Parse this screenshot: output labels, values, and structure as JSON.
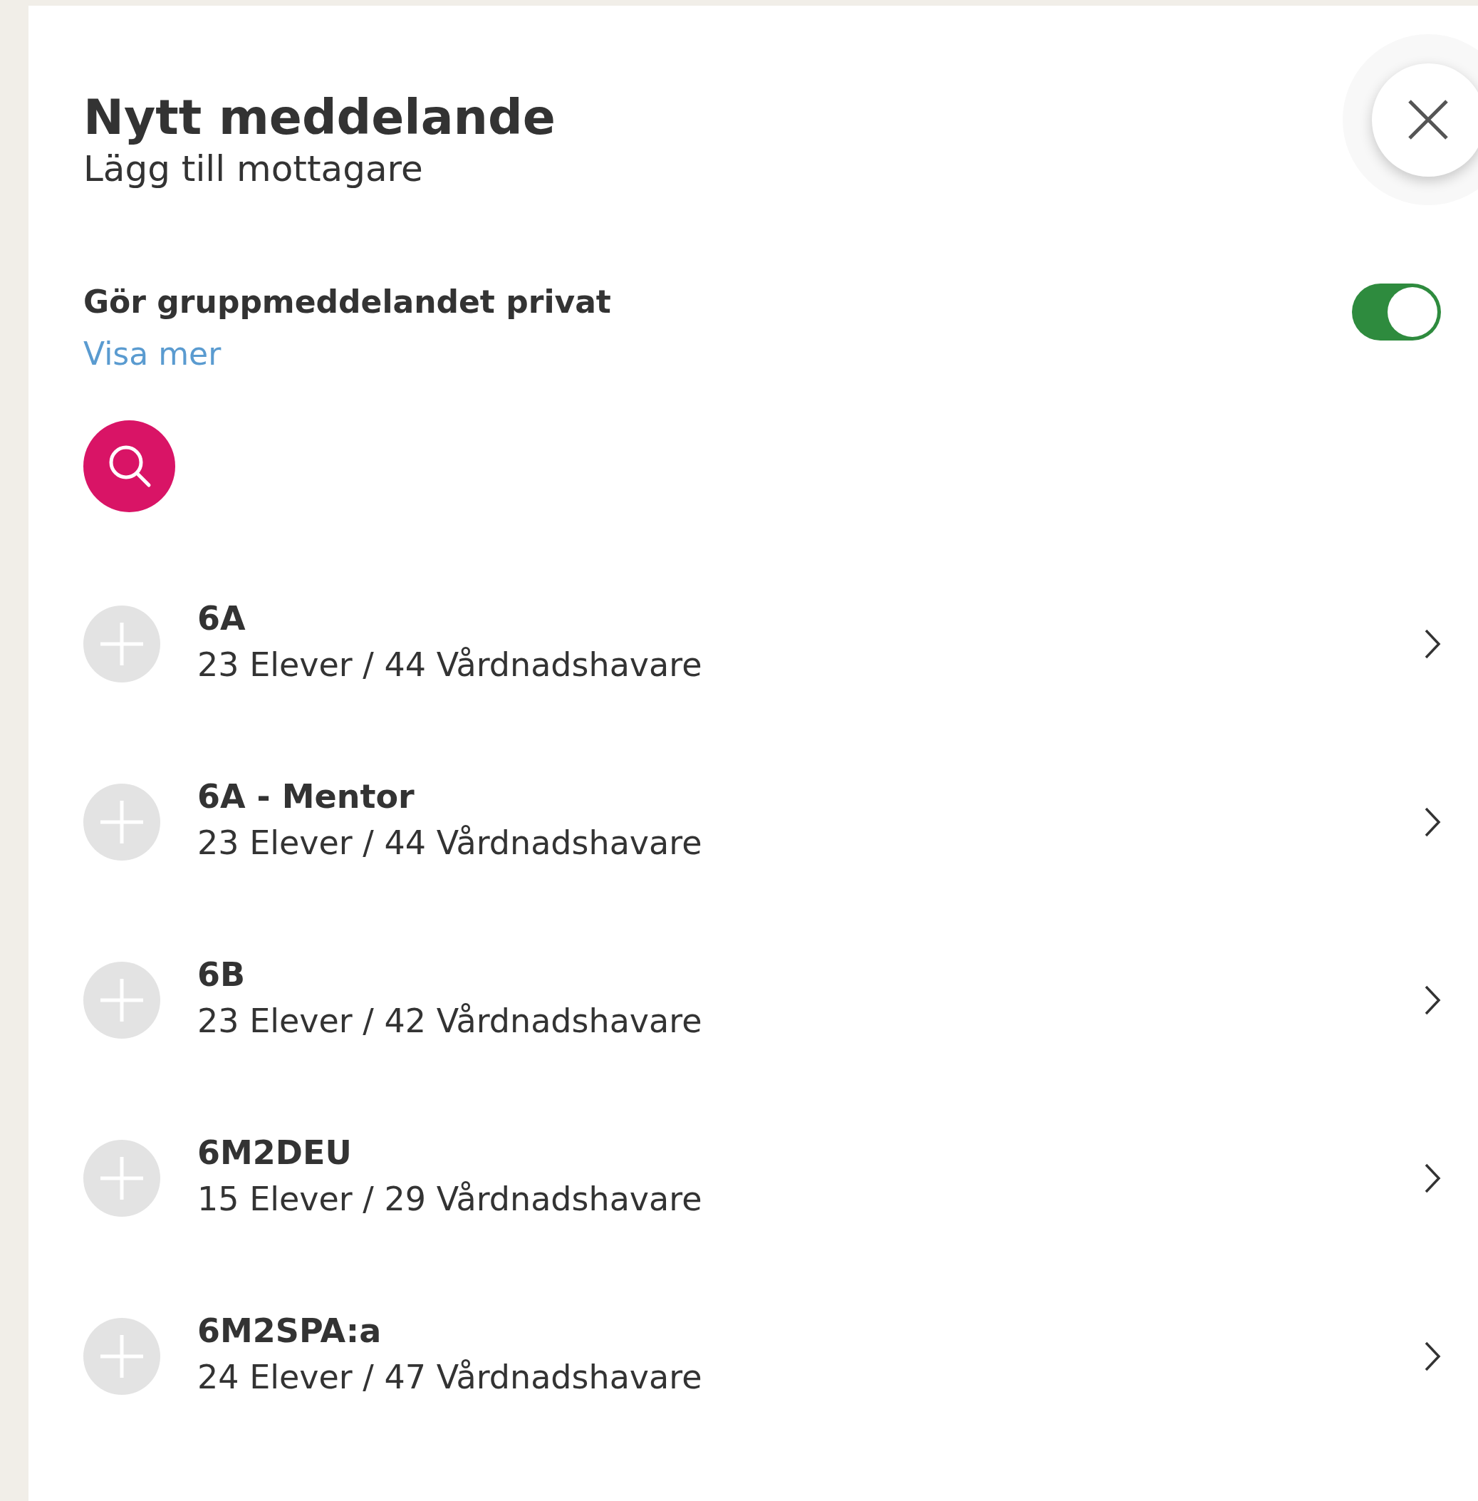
{
  "dialog": {
    "title": "Nytt meddelande",
    "subtitle": "Lägg till mottagare"
  },
  "privacy": {
    "label": "Gör gruppmeddelandet privat",
    "link": "Visa mer",
    "on": true
  },
  "recipients": [
    {
      "name": "6A",
      "details": "23 Elever / 44 Vårdnadshavare"
    },
    {
      "name": "6A - Mentor",
      "details": "23 Elever / 44 Vårdnadshavare"
    },
    {
      "name": "6B",
      "details": "23 Elever / 42 Vårdnadshavare"
    },
    {
      "name": "6M2DEU",
      "details": "15 Elever / 29 Vårdnadshavare"
    },
    {
      "name": "6M2SPA:a",
      "details": "24 Elever / 47 Vårdnadshavare"
    }
  ]
}
